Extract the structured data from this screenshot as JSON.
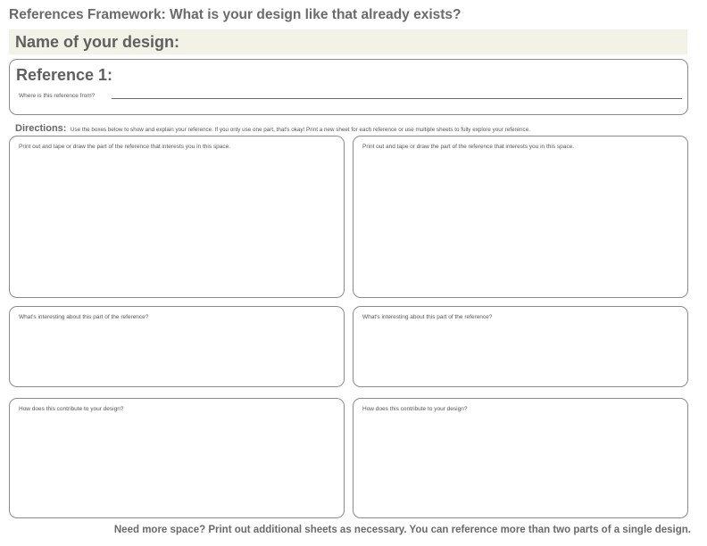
{
  "header": {
    "title": "References Framework: What is your design like that already exists?"
  },
  "name_section": {
    "label": "Name of your design:"
  },
  "reference": {
    "title": "Reference 1:",
    "source_prompt": "Where is this reference from?"
  },
  "directions": {
    "label": "Directions:",
    "text": "Use the boxes below to show and explain your reference. If you only use one part, that's okay! Print a new sheet for each reference or use multiple sheets to fully explore your reference."
  },
  "panels": {
    "left": {
      "image_prompt": "Print out and tape or draw the part of the reference that interests you in this space.",
      "interesting_prompt": "What's interesting about this part of the reference?",
      "contribute_prompt": "How does this contribute to your design?"
    },
    "right": {
      "image_prompt": "Print out and tape or draw the part of the reference that interests you in this space.",
      "interesting_prompt": "What's interesting about this part of the reference?",
      "contribute_prompt": "How does this contribute to your design?"
    }
  },
  "footer": {
    "note": "Need more space? Print out additional sheets as necessary. You can reference more than two parts of a single design."
  }
}
